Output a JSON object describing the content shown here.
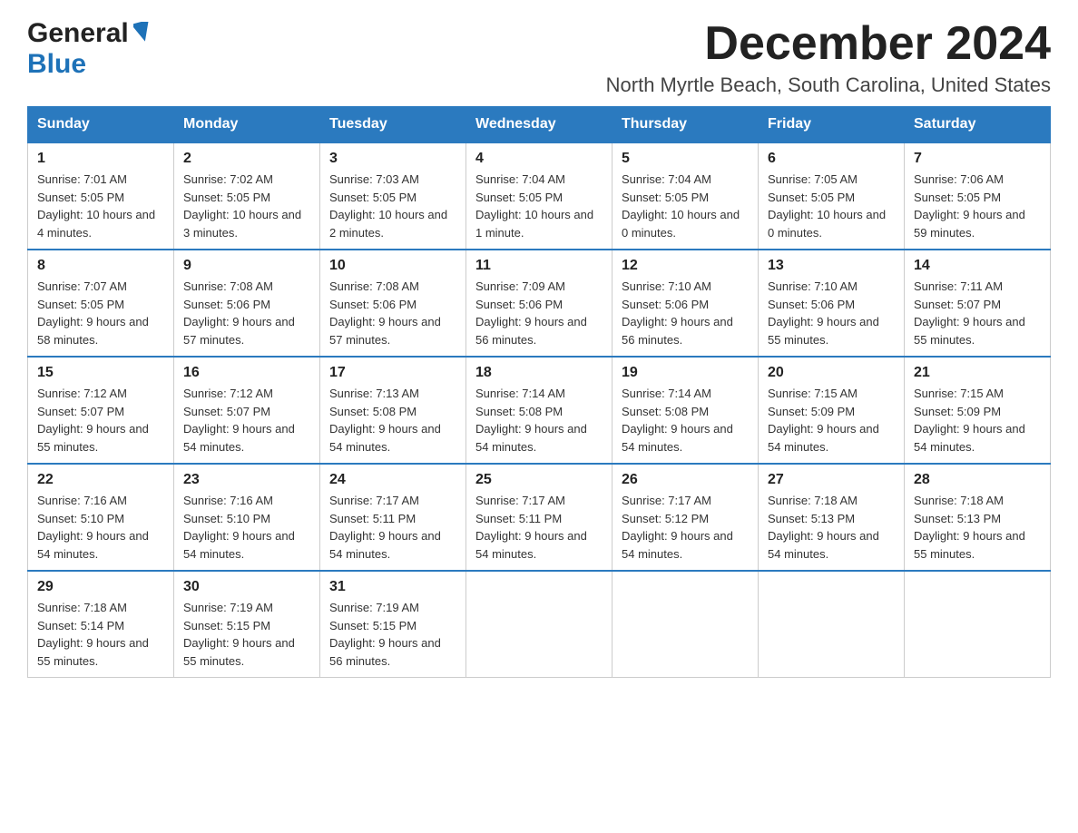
{
  "logo": {
    "general": "General",
    "blue": "Blue"
  },
  "title": {
    "month": "December 2024",
    "location": "North Myrtle Beach, South Carolina, United States"
  },
  "weekdays": [
    "Sunday",
    "Monday",
    "Tuesday",
    "Wednesday",
    "Thursday",
    "Friday",
    "Saturday"
  ],
  "weeks": [
    [
      {
        "day": 1,
        "sunrise": "7:01 AM",
        "sunset": "5:05 PM",
        "daylight": "10 hours and 4 minutes."
      },
      {
        "day": 2,
        "sunrise": "7:02 AM",
        "sunset": "5:05 PM",
        "daylight": "10 hours and 3 minutes."
      },
      {
        "day": 3,
        "sunrise": "7:03 AM",
        "sunset": "5:05 PM",
        "daylight": "10 hours and 2 minutes."
      },
      {
        "day": 4,
        "sunrise": "7:04 AM",
        "sunset": "5:05 PM",
        "daylight": "10 hours and 1 minute."
      },
      {
        "day": 5,
        "sunrise": "7:04 AM",
        "sunset": "5:05 PM",
        "daylight": "10 hours and 0 minutes."
      },
      {
        "day": 6,
        "sunrise": "7:05 AM",
        "sunset": "5:05 PM",
        "daylight": "10 hours and 0 minutes."
      },
      {
        "day": 7,
        "sunrise": "7:06 AM",
        "sunset": "5:05 PM",
        "daylight": "9 hours and 59 minutes."
      }
    ],
    [
      {
        "day": 8,
        "sunrise": "7:07 AM",
        "sunset": "5:05 PM",
        "daylight": "9 hours and 58 minutes."
      },
      {
        "day": 9,
        "sunrise": "7:08 AM",
        "sunset": "5:06 PM",
        "daylight": "9 hours and 57 minutes."
      },
      {
        "day": 10,
        "sunrise": "7:08 AM",
        "sunset": "5:06 PM",
        "daylight": "9 hours and 57 minutes."
      },
      {
        "day": 11,
        "sunrise": "7:09 AM",
        "sunset": "5:06 PM",
        "daylight": "9 hours and 56 minutes."
      },
      {
        "day": 12,
        "sunrise": "7:10 AM",
        "sunset": "5:06 PM",
        "daylight": "9 hours and 56 minutes."
      },
      {
        "day": 13,
        "sunrise": "7:10 AM",
        "sunset": "5:06 PM",
        "daylight": "9 hours and 55 minutes."
      },
      {
        "day": 14,
        "sunrise": "7:11 AM",
        "sunset": "5:07 PM",
        "daylight": "9 hours and 55 minutes."
      }
    ],
    [
      {
        "day": 15,
        "sunrise": "7:12 AM",
        "sunset": "5:07 PM",
        "daylight": "9 hours and 55 minutes."
      },
      {
        "day": 16,
        "sunrise": "7:12 AM",
        "sunset": "5:07 PM",
        "daylight": "9 hours and 54 minutes."
      },
      {
        "day": 17,
        "sunrise": "7:13 AM",
        "sunset": "5:08 PM",
        "daylight": "9 hours and 54 minutes."
      },
      {
        "day": 18,
        "sunrise": "7:14 AM",
        "sunset": "5:08 PM",
        "daylight": "9 hours and 54 minutes."
      },
      {
        "day": 19,
        "sunrise": "7:14 AM",
        "sunset": "5:08 PM",
        "daylight": "9 hours and 54 minutes."
      },
      {
        "day": 20,
        "sunrise": "7:15 AM",
        "sunset": "5:09 PM",
        "daylight": "9 hours and 54 minutes."
      },
      {
        "day": 21,
        "sunrise": "7:15 AM",
        "sunset": "5:09 PM",
        "daylight": "9 hours and 54 minutes."
      }
    ],
    [
      {
        "day": 22,
        "sunrise": "7:16 AM",
        "sunset": "5:10 PM",
        "daylight": "9 hours and 54 minutes."
      },
      {
        "day": 23,
        "sunrise": "7:16 AM",
        "sunset": "5:10 PM",
        "daylight": "9 hours and 54 minutes."
      },
      {
        "day": 24,
        "sunrise": "7:17 AM",
        "sunset": "5:11 PM",
        "daylight": "9 hours and 54 minutes."
      },
      {
        "day": 25,
        "sunrise": "7:17 AM",
        "sunset": "5:11 PM",
        "daylight": "9 hours and 54 minutes."
      },
      {
        "day": 26,
        "sunrise": "7:17 AM",
        "sunset": "5:12 PM",
        "daylight": "9 hours and 54 minutes."
      },
      {
        "day": 27,
        "sunrise": "7:18 AM",
        "sunset": "5:13 PM",
        "daylight": "9 hours and 54 minutes."
      },
      {
        "day": 28,
        "sunrise": "7:18 AM",
        "sunset": "5:13 PM",
        "daylight": "9 hours and 55 minutes."
      }
    ],
    [
      {
        "day": 29,
        "sunrise": "7:18 AM",
        "sunset": "5:14 PM",
        "daylight": "9 hours and 55 minutes."
      },
      {
        "day": 30,
        "sunrise": "7:19 AM",
        "sunset": "5:15 PM",
        "daylight": "9 hours and 55 minutes."
      },
      {
        "day": 31,
        "sunrise": "7:19 AM",
        "sunset": "5:15 PM",
        "daylight": "9 hours and 56 minutes."
      },
      null,
      null,
      null,
      null
    ]
  ],
  "labels": {
    "sunrise": "Sunrise:",
    "sunset": "Sunset:",
    "daylight": "Daylight:"
  }
}
